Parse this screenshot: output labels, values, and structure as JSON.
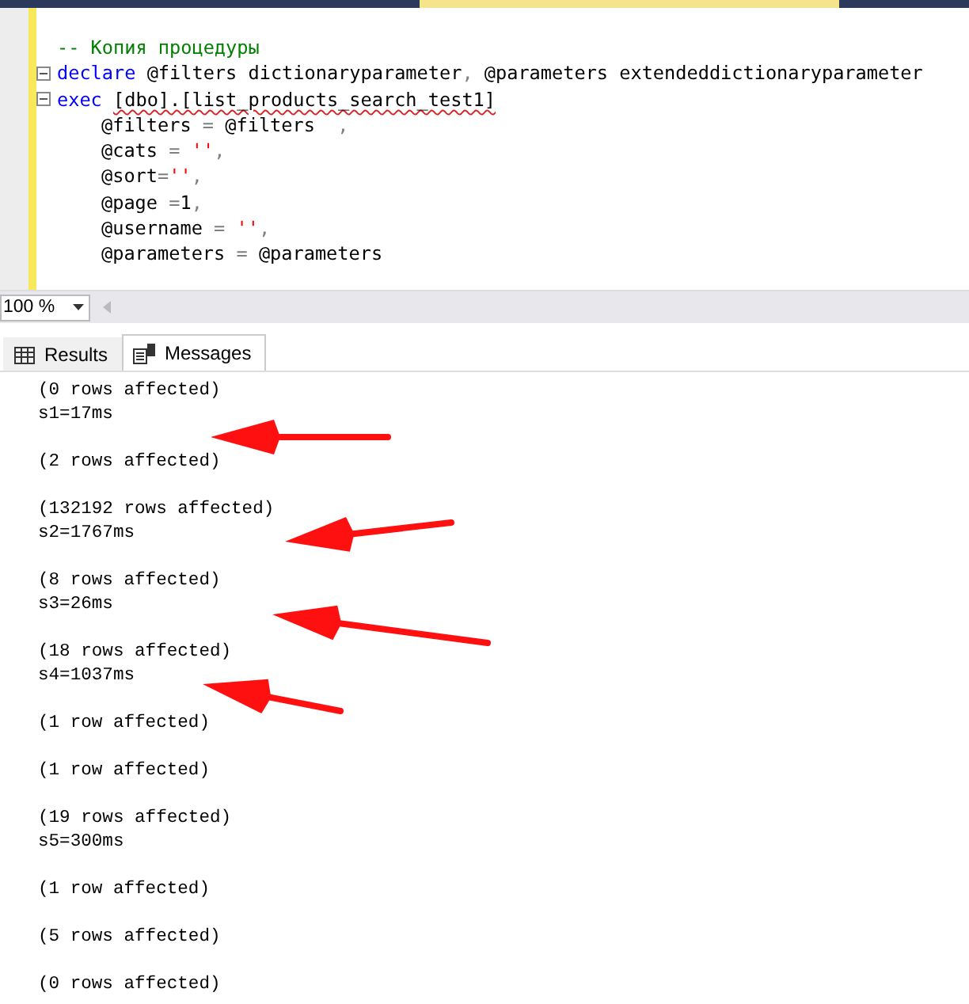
{
  "editor": {
    "lines": [
      {
        "fold": false,
        "indent": false,
        "segments": [
          {
            "kind": "comment",
            "text": "-- Копия процедуры"
          }
        ]
      },
      {
        "fold": true,
        "indent": false,
        "segments": [
          {
            "kind": "keyword",
            "text": "declare"
          },
          {
            "kind": "plain",
            "text": " @filters dictionaryparameter"
          },
          {
            "kind": "op",
            "text": ","
          },
          {
            "kind": "plain",
            "text": " @parameters extendeddictionaryparameter"
          }
        ]
      },
      {
        "fold": true,
        "indent": false,
        "segments": [
          {
            "kind": "keyword",
            "text": "exec "
          },
          {
            "kind": "error",
            "text": "[dbo].[list_products_search_test1]"
          }
        ]
      },
      {
        "fold": false,
        "indent": true,
        "segments": [
          {
            "kind": "plain",
            "text": "@filters "
          },
          {
            "kind": "op",
            "text": "="
          },
          {
            "kind": "plain",
            "text": " @filters  "
          },
          {
            "kind": "op",
            "text": ","
          }
        ]
      },
      {
        "fold": false,
        "indent": true,
        "segments": [
          {
            "kind": "plain",
            "text": "@cats "
          },
          {
            "kind": "op",
            "text": "= "
          },
          {
            "kind": "string",
            "text": "''"
          },
          {
            "kind": "op",
            "text": ","
          }
        ]
      },
      {
        "fold": false,
        "indent": true,
        "segments": [
          {
            "kind": "plain",
            "text": "@sort"
          },
          {
            "kind": "op",
            "text": "="
          },
          {
            "kind": "string",
            "text": "''"
          },
          {
            "kind": "op",
            "text": ","
          }
        ]
      },
      {
        "fold": false,
        "indent": true,
        "segments": [
          {
            "kind": "plain",
            "text": "@page "
          },
          {
            "kind": "op",
            "text": "="
          },
          {
            "kind": "plain",
            "text": "1"
          },
          {
            "kind": "op",
            "text": ","
          }
        ]
      },
      {
        "fold": false,
        "indent": true,
        "segments": [
          {
            "kind": "plain",
            "text": "@username "
          },
          {
            "kind": "op",
            "text": "= "
          },
          {
            "kind": "string",
            "text": "''"
          },
          {
            "kind": "op",
            "text": ","
          }
        ]
      },
      {
        "fold": false,
        "indent": true,
        "segments": [
          {
            "kind": "plain",
            "text": "@parameters "
          },
          {
            "kind": "op",
            "text": "="
          },
          {
            "kind": "plain",
            "text": " @parameters"
          }
        ]
      }
    ]
  },
  "zoom": {
    "value": "100 %"
  },
  "tabs": [
    {
      "label": "Results",
      "kind": "grid",
      "selected": false
    },
    {
      "label": "Messages",
      "kind": "messages",
      "selected": true
    }
  ],
  "messages": [
    {
      "rows": "(0 rows affected)",
      "timing": "s1=17ms"
    },
    {
      "rows": "(2 rows affected)"
    },
    {
      "rows": "(132192 rows affected)",
      "timing": "s2=1767ms"
    },
    {
      "rows": "(8 rows affected)",
      "timing": "s3=26ms"
    },
    {
      "rows": "(18 rows affected)",
      "timing": "s4=1037ms"
    },
    {
      "rows": "(1 row affected)"
    },
    {
      "rows": "(1 row affected)"
    },
    {
      "rows": "(19 rows affected)",
      "timing": "s5=300ms"
    },
    {
      "rows": "(1 row affected)"
    },
    {
      "rows": "(5 rows affected)"
    },
    {
      "rows": "(0 rows affected)"
    }
  ]
}
